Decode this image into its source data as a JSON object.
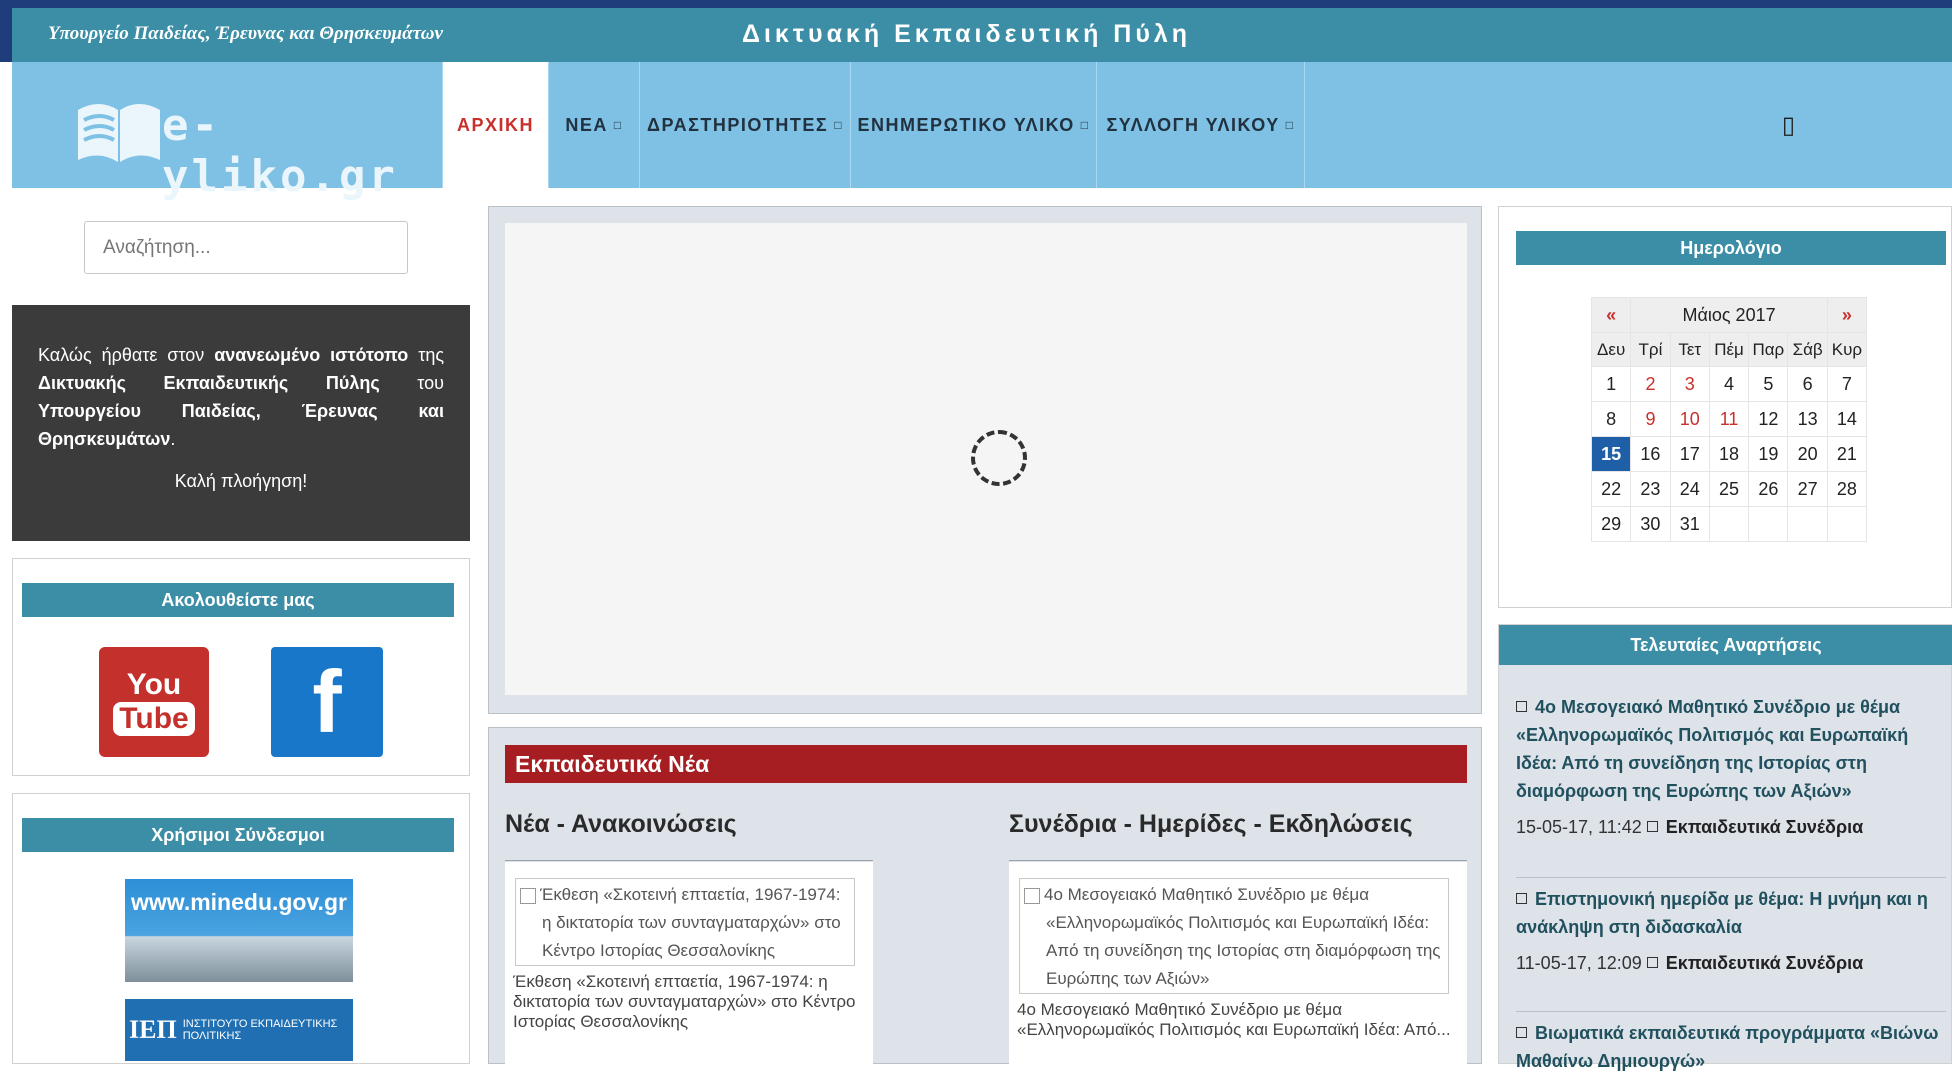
{
  "header": {
    "ministry": "Υπουργείο Παιδείας, Έρευνας και Θρησκευμάτων",
    "portal": "Δικτυακή Εκπαιδευτική Πύλη",
    "logo_text": "e-yliko.gr"
  },
  "nav": {
    "items": [
      {
        "label": "ΑΡΧΙΚΗ",
        "active": true
      },
      {
        "label": "ΝΕΑ",
        "dropdown": true
      },
      {
        "label": "ΔΡΑΣΤΗΡΙΟΤΗΤΕΣ",
        "dropdown": true
      },
      {
        "label": "ΕΝΗΜΕΡΩΤΙΚΟ ΥΛΙΚΟ",
        "dropdown": true
      },
      {
        "label": "ΣΥΛΛΟΓΗ ΥΛΙΚΟΥ",
        "dropdown": true
      }
    ],
    "caret": "□",
    "search_glyph": "▯"
  },
  "sidebar": {
    "search_placeholder": "Αναζήτηση...",
    "welcome": {
      "p1": "Καλώς ήρθατε στον ",
      "p2": "ανανεωμένο ιστότοπο",
      "p3": " της ",
      "p4": "Δικτυακής Εκπαιδευτικής Πύλης",
      "p5": " του ",
      "p6": "Υπουργείου Παιδείας, Έρευνας και Θρησκευμάτων",
      "p7": ".",
      "bye": "Καλή πλοήγηση!"
    },
    "follow_title": "Ακολουθείστε μας",
    "youtube": {
      "you": "You",
      "tube": "Tube"
    },
    "facebook": "f",
    "links_title": "Χρήσιμοι Σύνδεσμοι",
    "minedu": "www.minedu.gov.gr",
    "iep": {
      "mark": "ΙΕΠ",
      "text": "ΙΝΣΤΙΤΟΥΤΟ ΕΚΠΑΙΔΕΥΤΙΚΗΣ ΠΟΛΙΤΙΚΗΣ"
    }
  },
  "news": {
    "header": "Εκπαιδευτικά Νέα",
    "col1": {
      "title": "Νέα - Ανακοινώσεις",
      "img_alt": "Έκθεση «Σκοτεινή επταετία, 1967-1974: η δικτατορία των συνταγματαρχών» στο Κέντρο Ιστορίας Θεσσαλονίκης",
      "text": "Έκθεση «Σκοτεινή επταετία, 1967-1974: η δικτατορία των συνταγματαρχών» στο Κέντρο Ιστορίας Θεσσαλονίκης"
    },
    "col2": {
      "title": "Συνέδρια - Ημερίδες - Εκδηλώσεις",
      "img_alt": "4ο Μεσογειακό Μαθητικό Συνέδριο με θέμα «Ελληνορωμαϊκός Πολιτισμός και Ευρωπαϊκή Ιδέα: Από τη συνείδηση της Ιστορίας στη διαμόρφωση της Ευρώπης των Αξιών»",
      "text": "4ο Μεσογειακό Μαθητικό Συνέδριο με θέμα «Ελληνορωμαϊκός Πολιτισμός και Ευρωπαϊκή Ιδέα: Από..."
    }
  },
  "calendar": {
    "title": "Ημερολόγιο",
    "prev": "«",
    "next": "»",
    "month": "Μάιος 2017",
    "weekdays": [
      "Δευ",
      "Τρί",
      "Τετ",
      "Πέμ",
      "Παρ",
      "Σάβ",
      "Κυρ"
    ],
    "weeks": [
      [
        "1",
        "2",
        "3",
        "4",
        "5",
        "6",
        "7"
      ],
      [
        "8",
        "9",
        "10",
        "11",
        "12",
        "13",
        "14"
      ],
      [
        "15",
        "16",
        "17",
        "18",
        "19",
        "20",
        "21"
      ],
      [
        "22",
        "23",
        "24",
        "25",
        "26",
        "27",
        "28"
      ],
      [
        "29",
        "30",
        "31",
        "",
        "",
        "",
        ""
      ]
    ],
    "highlighted_days": [
      "2",
      "3",
      "9",
      "10",
      "11"
    ],
    "today": "15"
  },
  "posts": {
    "title": "Τελευταίες Αναρτήσεις",
    "items": [
      {
        "title": "4ο Μεσογειακό Μαθητικό Συνέδριο με θέμα «Ελληνορωμαϊκός Πολιτισμός και Ευρωπαϊκή Ιδέα: Από τη συνείδηση της Ιστορίας στη διαμόρφωση της Ευρώπης των Αξιών»",
        "date": "15-05-17, 11:42",
        "category": "Εκπαιδευτικά Συνέδρια"
      },
      {
        "title": "Επιστημονική ημερίδα με θέμα: Η μνήμη και η ανάκληψη στη διδασκαλία",
        "date": "11-05-17, 12:09",
        "category": "Εκπαιδευτικά Συνέδρια"
      },
      {
        "title": "Βιωματικά εκπαιδευτικά προγράμματα «Βιώνω Μαθαίνω Δημιουργώ»",
        "date": "",
        "category": ""
      }
    ]
  },
  "colors": {
    "accent": "#3b8ea5",
    "nav": "#7fc1e4",
    "news_red": "#a61e22",
    "active_red": "#c9302c"
  }
}
